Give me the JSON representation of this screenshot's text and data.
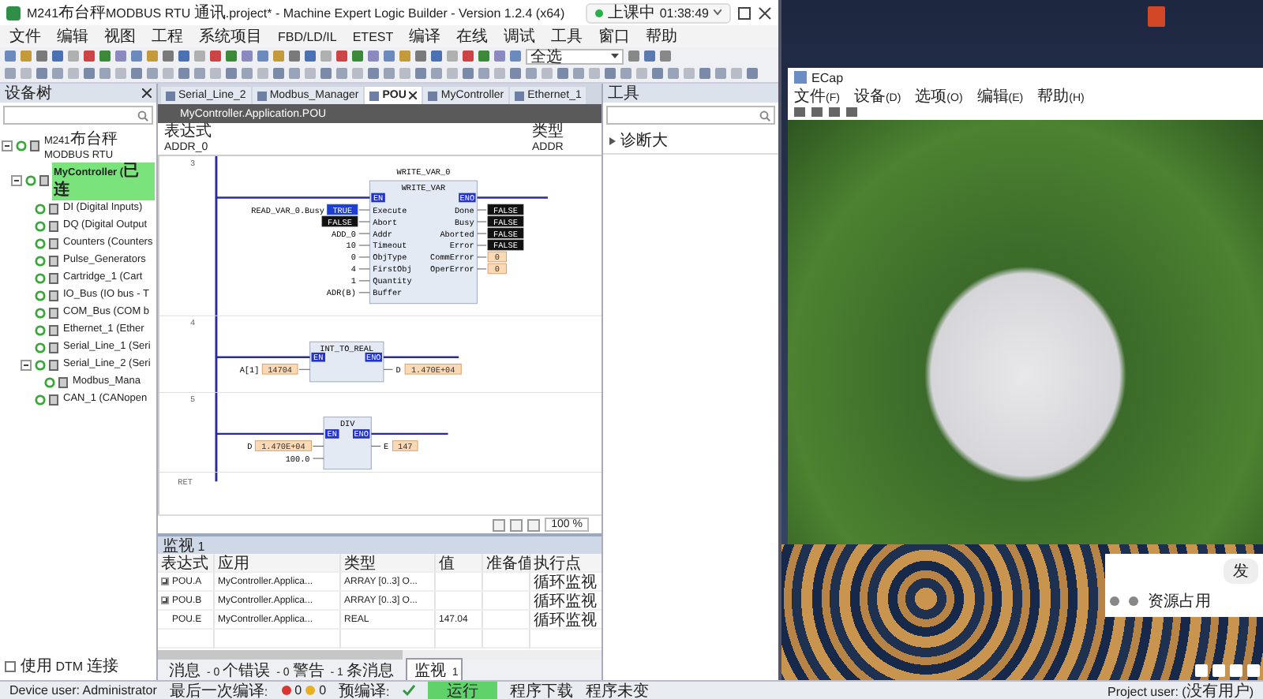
{
  "window": {
    "title": "M241布台秤MODBUS RTU 通讯.project* - Machine Expert Logic Builder - Version 1.2.4 (x64)"
  },
  "recording": {
    "status": "上课中 01:38:49"
  },
  "menu": [
    "文件",
    "编辑",
    "视图",
    "工程",
    "系统项目",
    "FBD/LD/IL",
    "ETEST",
    "编译",
    "在线",
    "调试",
    "工具",
    "窗口",
    "帮助"
  ],
  "toolbar": {
    "selector": "全选"
  },
  "device_tree": {
    "title": "设备树",
    "items": [
      {
        "label": "M241布台秤MODBUS RTU",
        "expanded": true,
        "selected": false,
        "children": [
          {
            "label": "MyController (已连",
            "expanded": true,
            "selected": true,
            "children": [
              {
                "label": "DI (Digital Inputs)",
                "selected": false
              },
              {
                "label": "DQ (Digital Output",
                "selected": false
              },
              {
                "label": "Counters (Counters",
                "selected": false
              },
              {
                "label": "Pulse_Generators",
                "selected": false
              },
              {
                "label": "Cartridge_1 (Cart",
                "selected": false
              },
              {
                "label": "IO_Bus (IO bus - T",
                "selected": false
              },
              {
                "label": "COM_Bus (COM b",
                "selected": false
              },
              {
                "label": "Ethernet_1 (Ether",
                "selected": false
              },
              {
                "label": "Serial_Line_1 (Seri",
                "selected": false
              },
              {
                "label": "Serial_Line_2 (Seri",
                "expanded": true,
                "selected": false,
                "children": [
                  {
                    "label": "Modbus_Mana",
                    "selected": false
                  }
                ]
              },
              {
                "label": "CAN_1 (CANopen",
                "selected": false
              }
            ]
          }
        ]
      }
    ],
    "dtm_option": {
      "label": "使用 DTM 连接",
      "checked": false
    }
  },
  "editor": {
    "tabs": [
      {
        "label": "Serial_Line_2",
        "selected": false
      },
      {
        "label": "Modbus_Manager",
        "selected": false
      },
      {
        "label": "POU",
        "selected": true
      },
      {
        "label": "MyController",
        "selected": false
      },
      {
        "label": "Ethernet_1",
        "selected": false
      }
    ],
    "pou_title": "MyController.Application.POU",
    "variables": {
      "columns": [
        "表达式",
        "类型"
      ],
      "rows": [
        {
          "expression": "ADDR_0",
          "type": "ADDR"
        }
      ]
    },
    "diagram": {
      "networks": [
        {
          "number": "3",
          "block": {
            "instance": "WRITE_VAR_0",
            "type": "WRITE_VAR",
            "en": "EN",
            "eno": "ENO",
            "inputs": [
              {
                "pin": "Execute",
                "source": "READ_VAR_0.Busy",
                "value": "TRUE",
                "kind": "true"
              },
              {
                "pin": "Abort",
                "value": "FALSE",
                "kind": "false"
              },
              {
                "pin": "Addr",
                "source": "ADD_0"
              },
              {
                "pin": "Timeout",
                "source": "10"
              },
              {
                "pin": "ObjType",
                "source": "0"
              },
              {
                "pin": "FirstObj",
                "source": "4"
              },
              {
                "pin": "Quantity",
                "source": "1"
              },
              {
                "pin": "Buffer",
                "source": "ADR(B)"
              }
            ],
            "outputs": [
              {
                "pin": "Done",
                "value": "FALSE",
                "kind": "false"
              },
              {
                "pin": "Busy",
                "value": "FALSE",
                "kind": "false"
              },
              {
                "pin": "Aborted",
                "value": "FALSE",
                "kind": "false"
              },
              {
                "pin": "Error",
                "value": "FALSE",
                "kind": "false"
              },
              {
                "pin": "CommError",
                "value": "0",
                "kind": "number"
              },
              {
                "pin": "OperError",
                "value": "0",
                "kind": "number"
              }
            ]
          }
        },
        {
          "number": "4",
          "block": {
            "type": "INT_TO_REAL",
            "en": "EN",
            "eno": "ENO",
            "inputs": [
              {
                "source": "A[1]",
                "value": "14704",
                "kind": "number"
              }
            ],
            "outputs": [
              {
                "target": "D",
                "value": "1.470E+04",
                "kind": "number"
              }
            ]
          }
        },
        {
          "number": "5",
          "block": {
            "type": "DIV",
            "en": "EN",
            "eno": "ENO",
            "inputs": [
              {
                "source": "D",
                "value": "1.470E+04",
                "kind": "number"
              },
              {
                "source": "100.0"
              }
            ],
            "outputs": [
              {
                "target": "E",
                "value": "147",
                "kind": "number"
              }
            ]
          }
        }
      ],
      "end_label": "RET"
    },
    "zoom": "100 %"
  },
  "watch": {
    "title": "监视 1",
    "columns": [
      "表达式",
      "应用",
      "类型",
      "值",
      "准备值",
      "执行点"
    ],
    "rows": [
      {
        "kind": "array",
        "cells": [
          "POU.A",
          "MyController.Applica...",
          "ARRAY [0..3] O...",
          "",
          "",
          "循环监视"
        ]
      },
      {
        "kind": "array",
        "cells": [
          "POU.B",
          "MyController.Applica...",
          "ARRAY [0..3] O...",
          "",
          "",
          "循环监视"
        ]
      },
      {
        "kind": "scalar",
        "cells": [
          "POU.E",
          "MyController.Applica...",
          "REAL",
          "147.04",
          "",
          "循环监视"
        ]
      }
    ],
    "bottom_tabs": [
      {
        "label": "消息 - 0个错误 - 0警告 - 1条消息",
        "selected": false
      },
      {
        "label": "监视 1",
        "selected": true
      }
    ]
  },
  "tools_panel": {
    "title": "工具",
    "items": [
      {
        "label": "诊断大"
      }
    ]
  },
  "status_bar": {
    "device_user": "Device user: Administrator",
    "last_build": "最后一次编译:",
    "errors": "0",
    "warnings": "0",
    "precompile": "预编译:",
    "run_state": "运行",
    "download": "程序下载",
    "program": "程序未变",
    "project_user": "Project user: (没有用户)"
  },
  "ecap": {
    "title": "ECap",
    "menu": [
      "文件(F)",
      "设备(D)",
      "选项(O)",
      "编辑(E)",
      "帮助(H)"
    ]
  },
  "chat": {
    "send": "发",
    "resource": "资源占用"
  }
}
